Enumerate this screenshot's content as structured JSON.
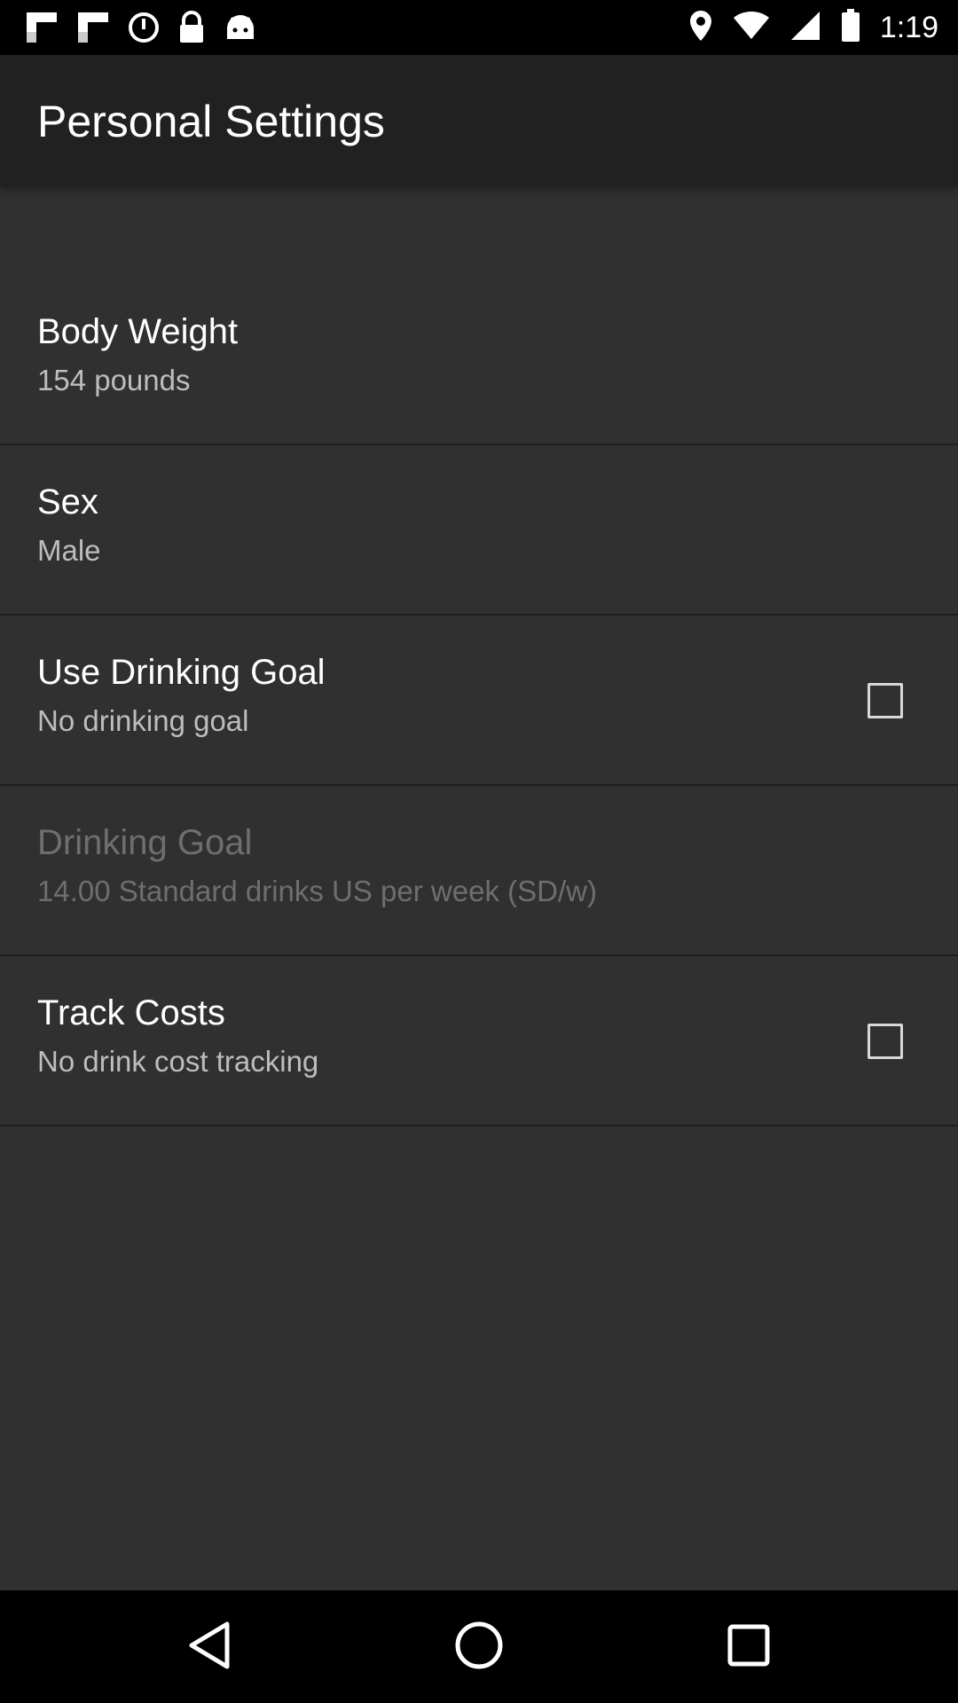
{
  "status_bar": {
    "time": "1:19",
    "icons": [
      "flipboard-icon",
      "flipboard-icon",
      "alarm-icon",
      "lock-icon",
      "android-icon",
      "location-icon",
      "wifi-icon",
      "signal-icon",
      "battery-icon"
    ]
  },
  "app_bar": {
    "title": "Personal Settings"
  },
  "preferences": [
    {
      "title": "Body Weight",
      "summary": "154 pounds",
      "has_checkbox": false,
      "enabled": true
    },
    {
      "title": "Sex",
      "summary": "Male",
      "has_checkbox": false,
      "enabled": true
    },
    {
      "title": "Use Drinking Goal",
      "summary": "No drinking goal",
      "has_checkbox": true,
      "checked": false,
      "enabled": true
    },
    {
      "title": "Drinking Goal",
      "summary": "14.00 Standard drinks US per week (SD/w)",
      "has_checkbox": false,
      "enabled": false
    },
    {
      "title": "Track Costs",
      "summary": "No drink cost tracking",
      "has_checkbox": true,
      "checked": false,
      "enabled": true
    }
  ],
  "nav_bar": {
    "icons": [
      "back-icon",
      "home-icon",
      "recents-icon"
    ]
  },
  "colors": {
    "background": "#303030",
    "app_bar": "#212121",
    "text_primary": "#ffffff",
    "text_secondary": "#bdbdbd",
    "text_disabled": "#6e6e6e"
  }
}
